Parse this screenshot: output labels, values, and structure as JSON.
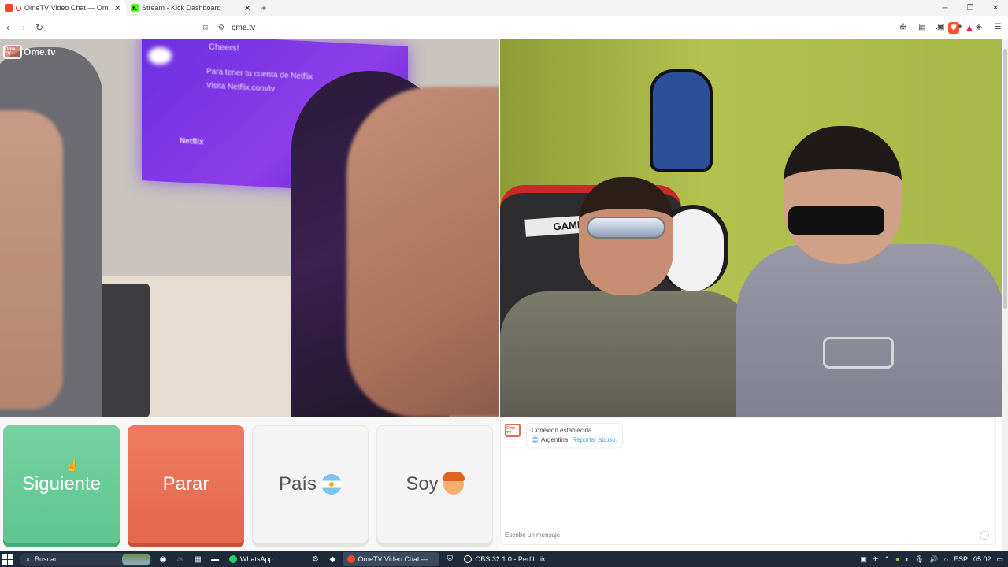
{
  "browser": {
    "tabs": [
      {
        "title": "OmeTV Video Chat — Omeg",
        "active": true
      },
      {
        "title": "Stream - Kick Dashboard",
        "active": false
      }
    ],
    "new_tab": "+",
    "url": "ome.tv"
  },
  "site": {
    "logo_text": "Ome.tv",
    "logo_box": "Ome TV"
  },
  "left_video": {
    "tv_line1": "Cheers!",
    "tv_line2": "Para tener tu cuenta de Netflix",
    "tv_line3": "Visita Netflix.com/tv",
    "tv_brand": "Netflix"
  },
  "right_video": {
    "chair_label": "GAME"
  },
  "controls": {
    "next_label": "Siguiente",
    "stop_label": "Parar",
    "country_label": "País",
    "gender_label": "Soy",
    "country_flag": "argentina-flag-icon",
    "gender_icon": "boy-face-icon"
  },
  "chat": {
    "status": "Conexión establecida.",
    "country": "Argentina.",
    "report_link": "Reportar abuso.",
    "input_placeholder": "Escribe un mensaje"
  },
  "taskbar": {
    "search_placeholder": "Buscar",
    "apps": [
      {
        "label": "WhatsApp",
        "active": false
      },
      {
        "label": "OmeTV Video Chat —...",
        "active": true
      },
      {
        "label": "OBS 32.1.0 - Perfil: tik...",
        "active": false
      }
    ],
    "lang": "ESP",
    "time": "05:02"
  },
  "colors": {
    "next": "#5ec58e",
    "stop": "#e3674c",
    "taskbar": "#1d2a3a",
    "link": "#4aa9c9"
  }
}
